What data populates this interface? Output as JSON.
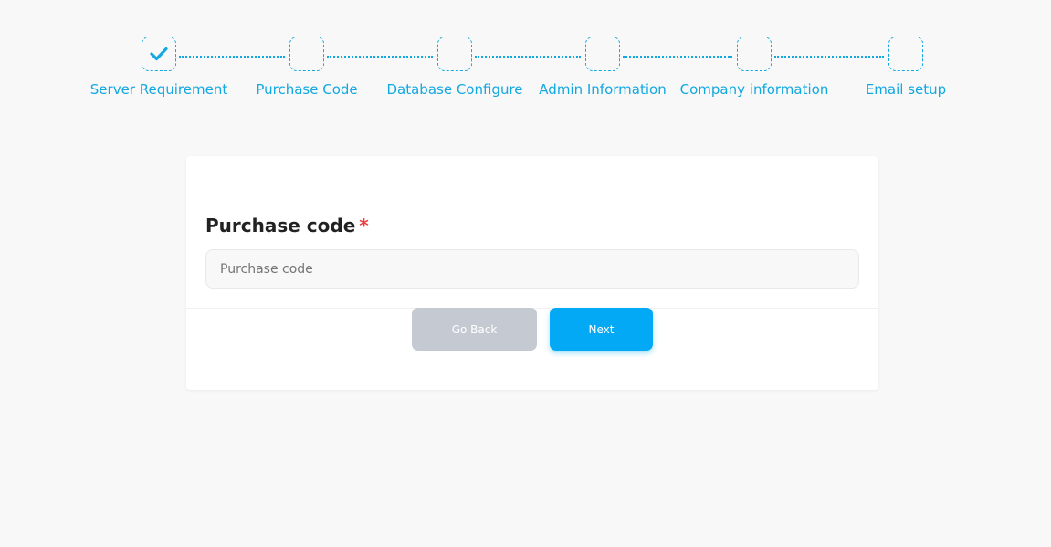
{
  "accent_color": "#12a8e0",
  "stepper": {
    "steps": [
      {
        "label": "Server Requirement",
        "completed": true,
        "icon": "check-icon"
      },
      {
        "label": "Purchase Code",
        "completed": false
      },
      {
        "label": "Database Configure",
        "completed": false
      },
      {
        "label": "Admin Information",
        "completed": false
      },
      {
        "label": "Company information",
        "completed": false
      },
      {
        "label": "Email setup",
        "completed": false
      }
    ]
  },
  "form": {
    "label": "Purchase code",
    "required_mark": "*",
    "input_placeholder": "Purchase code",
    "input_value": ""
  },
  "actions": {
    "back_label": "Go Back",
    "next_label": "Next"
  }
}
